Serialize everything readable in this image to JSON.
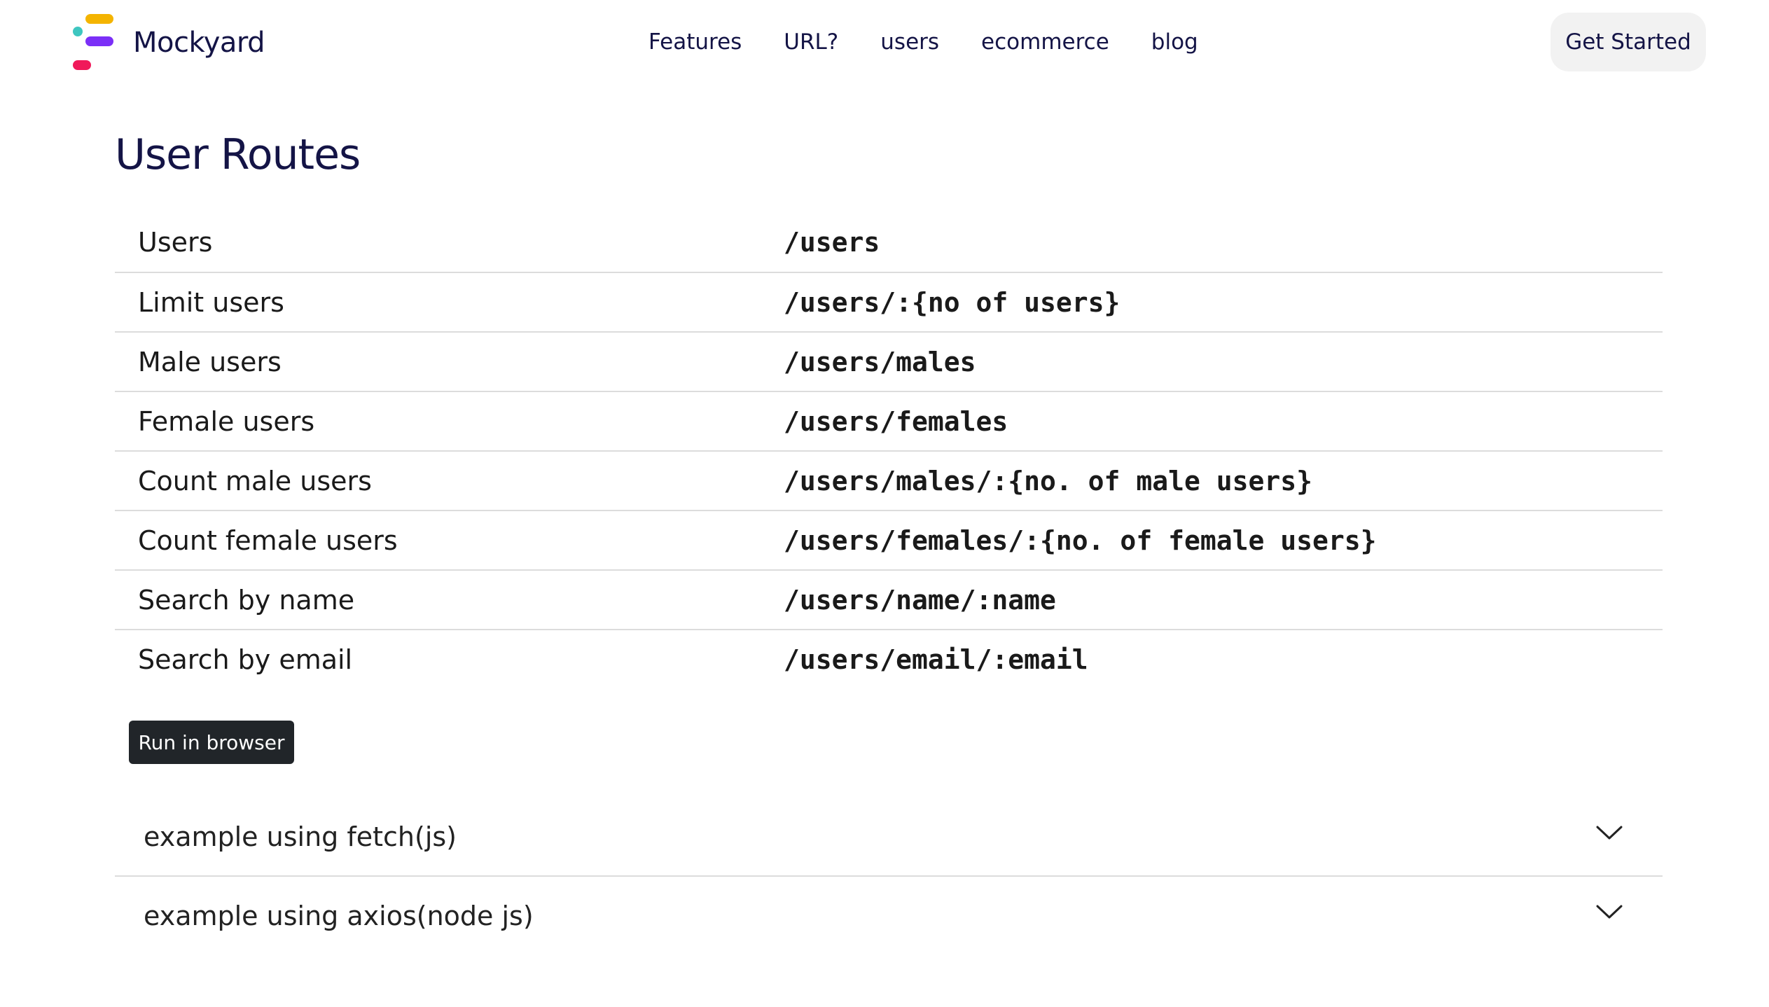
{
  "brand": {
    "name": "Mockyard",
    "logo_colors": [
      "#f4b400",
      "#3ec6c0",
      "#7b2ff7",
      "#f0195a"
    ]
  },
  "nav": {
    "links": [
      "Features",
      "URL?",
      "users",
      "ecommerce",
      "blog"
    ],
    "cta": "Get Started"
  },
  "main": {
    "title": "User Routes",
    "routes": [
      {
        "name": "Users",
        "path": "/users"
      },
      {
        "name": "Limit users",
        "path": "/users/:{no of users}"
      },
      {
        "name": "Male users",
        "path": "/users/males"
      },
      {
        "name": "Female users",
        "path": "/users/females"
      },
      {
        "name": "Count male users",
        "path": "/users/males/:{no. of male users}"
      },
      {
        "name": "Count female users",
        "path": "/users/females/:{no. of female users}"
      },
      {
        "name": "Search by name",
        "path": "/users/name/:name"
      },
      {
        "name": "Search by email",
        "path": "/users/email/:email"
      }
    ],
    "run_button": "Run in browser",
    "examples": [
      {
        "label": "example using fetch(js)",
        "icon": "chevron-down-icon"
      },
      {
        "label": "example using axios(node js)",
        "icon": "chevron-down-icon"
      }
    ]
  },
  "colors": {
    "text_primary": "#141446",
    "button_dark": "#212529",
    "cta_bg": "#f2f2f2",
    "divider": "#dcdcdc"
  }
}
